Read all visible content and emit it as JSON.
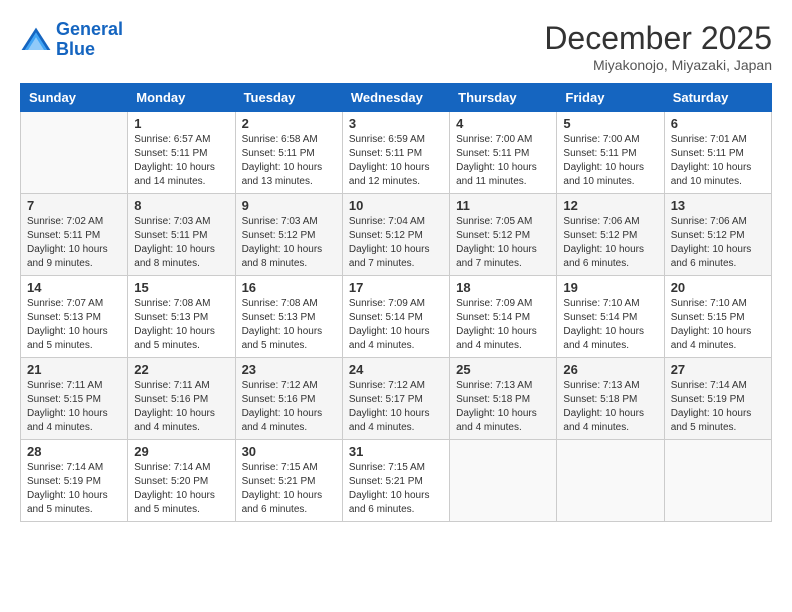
{
  "logo": {
    "line1": "General",
    "line2": "Blue"
  },
  "title": "December 2025",
  "subtitle": "Miyakonojo, Miyazaki, Japan",
  "weekdays": [
    "Sunday",
    "Monday",
    "Tuesday",
    "Wednesday",
    "Thursday",
    "Friday",
    "Saturday"
  ],
  "weeks": [
    [
      {
        "day": "",
        "info": ""
      },
      {
        "day": "1",
        "info": "Sunrise: 6:57 AM\nSunset: 5:11 PM\nDaylight: 10 hours\nand 14 minutes."
      },
      {
        "day": "2",
        "info": "Sunrise: 6:58 AM\nSunset: 5:11 PM\nDaylight: 10 hours\nand 13 minutes."
      },
      {
        "day": "3",
        "info": "Sunrise: 6:59 AM\nSunset: 5:11 PM\nDaylight: 10 hours\nand 12 minutes."
      },
      {
        "day": "4",
        "info": "Sunrise: 7:00 AM\nSunset: 5:11 PM\nDaylight: 10 hours\nand 11 minutes."
      },
      {
        "day": "5",
        "info": "Sunrise: 7:00 AM\nSunset: 5:11 PM\nDaylight: 10 hours\nand 10 minutes."
      },
      {
        "day": "6",
        "info": "Sunrise: 7:01 AM\nSunset: 5:11 PM\nDaylight: 10 hours\nand 10 minutes."
      }
    ],
    [
      {
        "day": "7",
        "info": "Sunrise: 7:02 AM\nSunset: 5:11 PM\nDaylight: 10 hours\nand 9 minutes."
      },
      {
        "day": "8",
        "info": "Sunrise: 7:03 AM\nSunset: 5:11 PM\nDaylight: 10 hours\nand 8 minutes."
      },
      {
        "day": "9",
        "info": "Sunrise: 7:03 AM\nSunset: 5:12 PM\nDaylight: 10 hours\nand 8 minutes."
      },
      {
        "day": "10",
        "info": "Sunrise: 7:04 AM\nSunset: 5:12 PM\nDaylight: 10 hours\nand 7 minutes."
      },
      {
        "day": "11",
        "info": "Sunrise: 7:05 AM\nSunset: 5:12 PM\nDaylight: 10 hours\nand 7 minutes."
      },
      {
        "day": "12",
        "info": "Sunrise: 7:06 AM\nSunset: 5:12 PM\nDaylight: 10 hours\nand 6 minutes."
      },
      {
        "day": "13",
        "info": "Sunrise: 7:06 AM\nSunset: 5:12 PM\nDaylight: 10 hours\nand 6 minutes."
      }
    ],
    [
      {
        "day": "14",
        "info": "Sunrise: 7:07 AM\nSunset: 5:13 PM\nDaylight: 10 hours\nand 5 minutes."
      },
      {
        "day": "15",
        "info": "Sunrise: 7:08 AM\nSunset: 5:13 PM\nDaylight: 10 hours\nand 5 minutes."
      },
      {
        "day": "16",
        "info": "Sunrise: 7:08 AM\nSunset: 5:13 PM\nDaylight: 10 hours\nand 5 minutes."
      },
      {
        "day": "17",
        "info": "Sunrise: 7:09 AM\nSunset: 5:14 PM\nDaylight: 10 hours\nand 4 minutes."
      },
      {
        "day": "18",
        "info": "Sunrise: 7:09 AM\nSunset: 5:14 PM\nDaylight: 10 hours\nand 4 minutes."
      },
      {
        "day": "19",
        "info": "Sunrise: 7:10 AM\nSunset: 5:14 PM\nDaylight: 10 hours\nand 4 minutes."
      },
      {
        "day": "20",
        "info": "Sunrise: 7:10 AM\nSunset: 5:15 PM\nDaylight: 10 hours\nand 4 minutes."
      }
    ],
    [
      {
        "day": "21",
        "info": "Sunrise: 7:11 AM\nSunset: 5:15 PM\nDaylight: 10 hours\nand 4 minutes."
      },
      {
        "day": "22",
        "info": "Sunrise: 7:11 AM\nSunset: 5:16 PM\nDaylight: 10 hours\nand 4 minutes."
      },
      {
        "day": "23",
        "info": "Sunrise: 7:12 AM\nSunset: 5:16 PM\nDaylight: 10 hours\nand 4 minutes."
      },
      {
        "day": "24",
        "info": "Sunrise: 7:12 AM\nSunset: 5:17 PM\nDaylight: 10 hours\nand 4 minutes."
      },
      {
        "day": "25",
        "info": "Sunrise: 7:13 AM\nSunset: 5:18 PM\nDaylight: 10 hours\nand 4 minutes."
      },
      {
        "day": "26",
        "info": "Sunrise: 7:13 AM\nSunset: 5:18 PM\nDaylight: 10 hours\nand 4 minutes."
      },
      {
        "day": "27",
        "info": "Sunrise: 7:14 AM\nSunset: 5:19 PM\nDaylight: 10 hours\nand 5 minutes."
      }
    ],
    [
      {
        "day": "28",
        "info": "Sunrise: 7:14 AM\nSunset: 5:19 PM\nDaylight: 10 hours\nand 5 minutes."
      },
      {
        "day": "29",
        "info": "Sunrise: 7:14 AM\nSunset: 5:20 PM\nDaylight: 10 hours\nand 5 minutes."
      },
      {
        "day": "30",
        "info": "Sunrise: 7:15 AM\nSunset: 5:21 PM\nDaylight: 10 hours\nand 6 minutes."
      },
      {
        "day": "31",
        "info": "Sunrise: 7:15 AM\nSunset: 5:21 PM\nDaylight: 10 hours\nand 6 minutes."
      },
      {
        "day": "",
        "info": ""
      },
      {
        "day": "",
        "info": ""
      },
      {
        "day": "",
        "info": ""
      }
    ]
  ]
}
